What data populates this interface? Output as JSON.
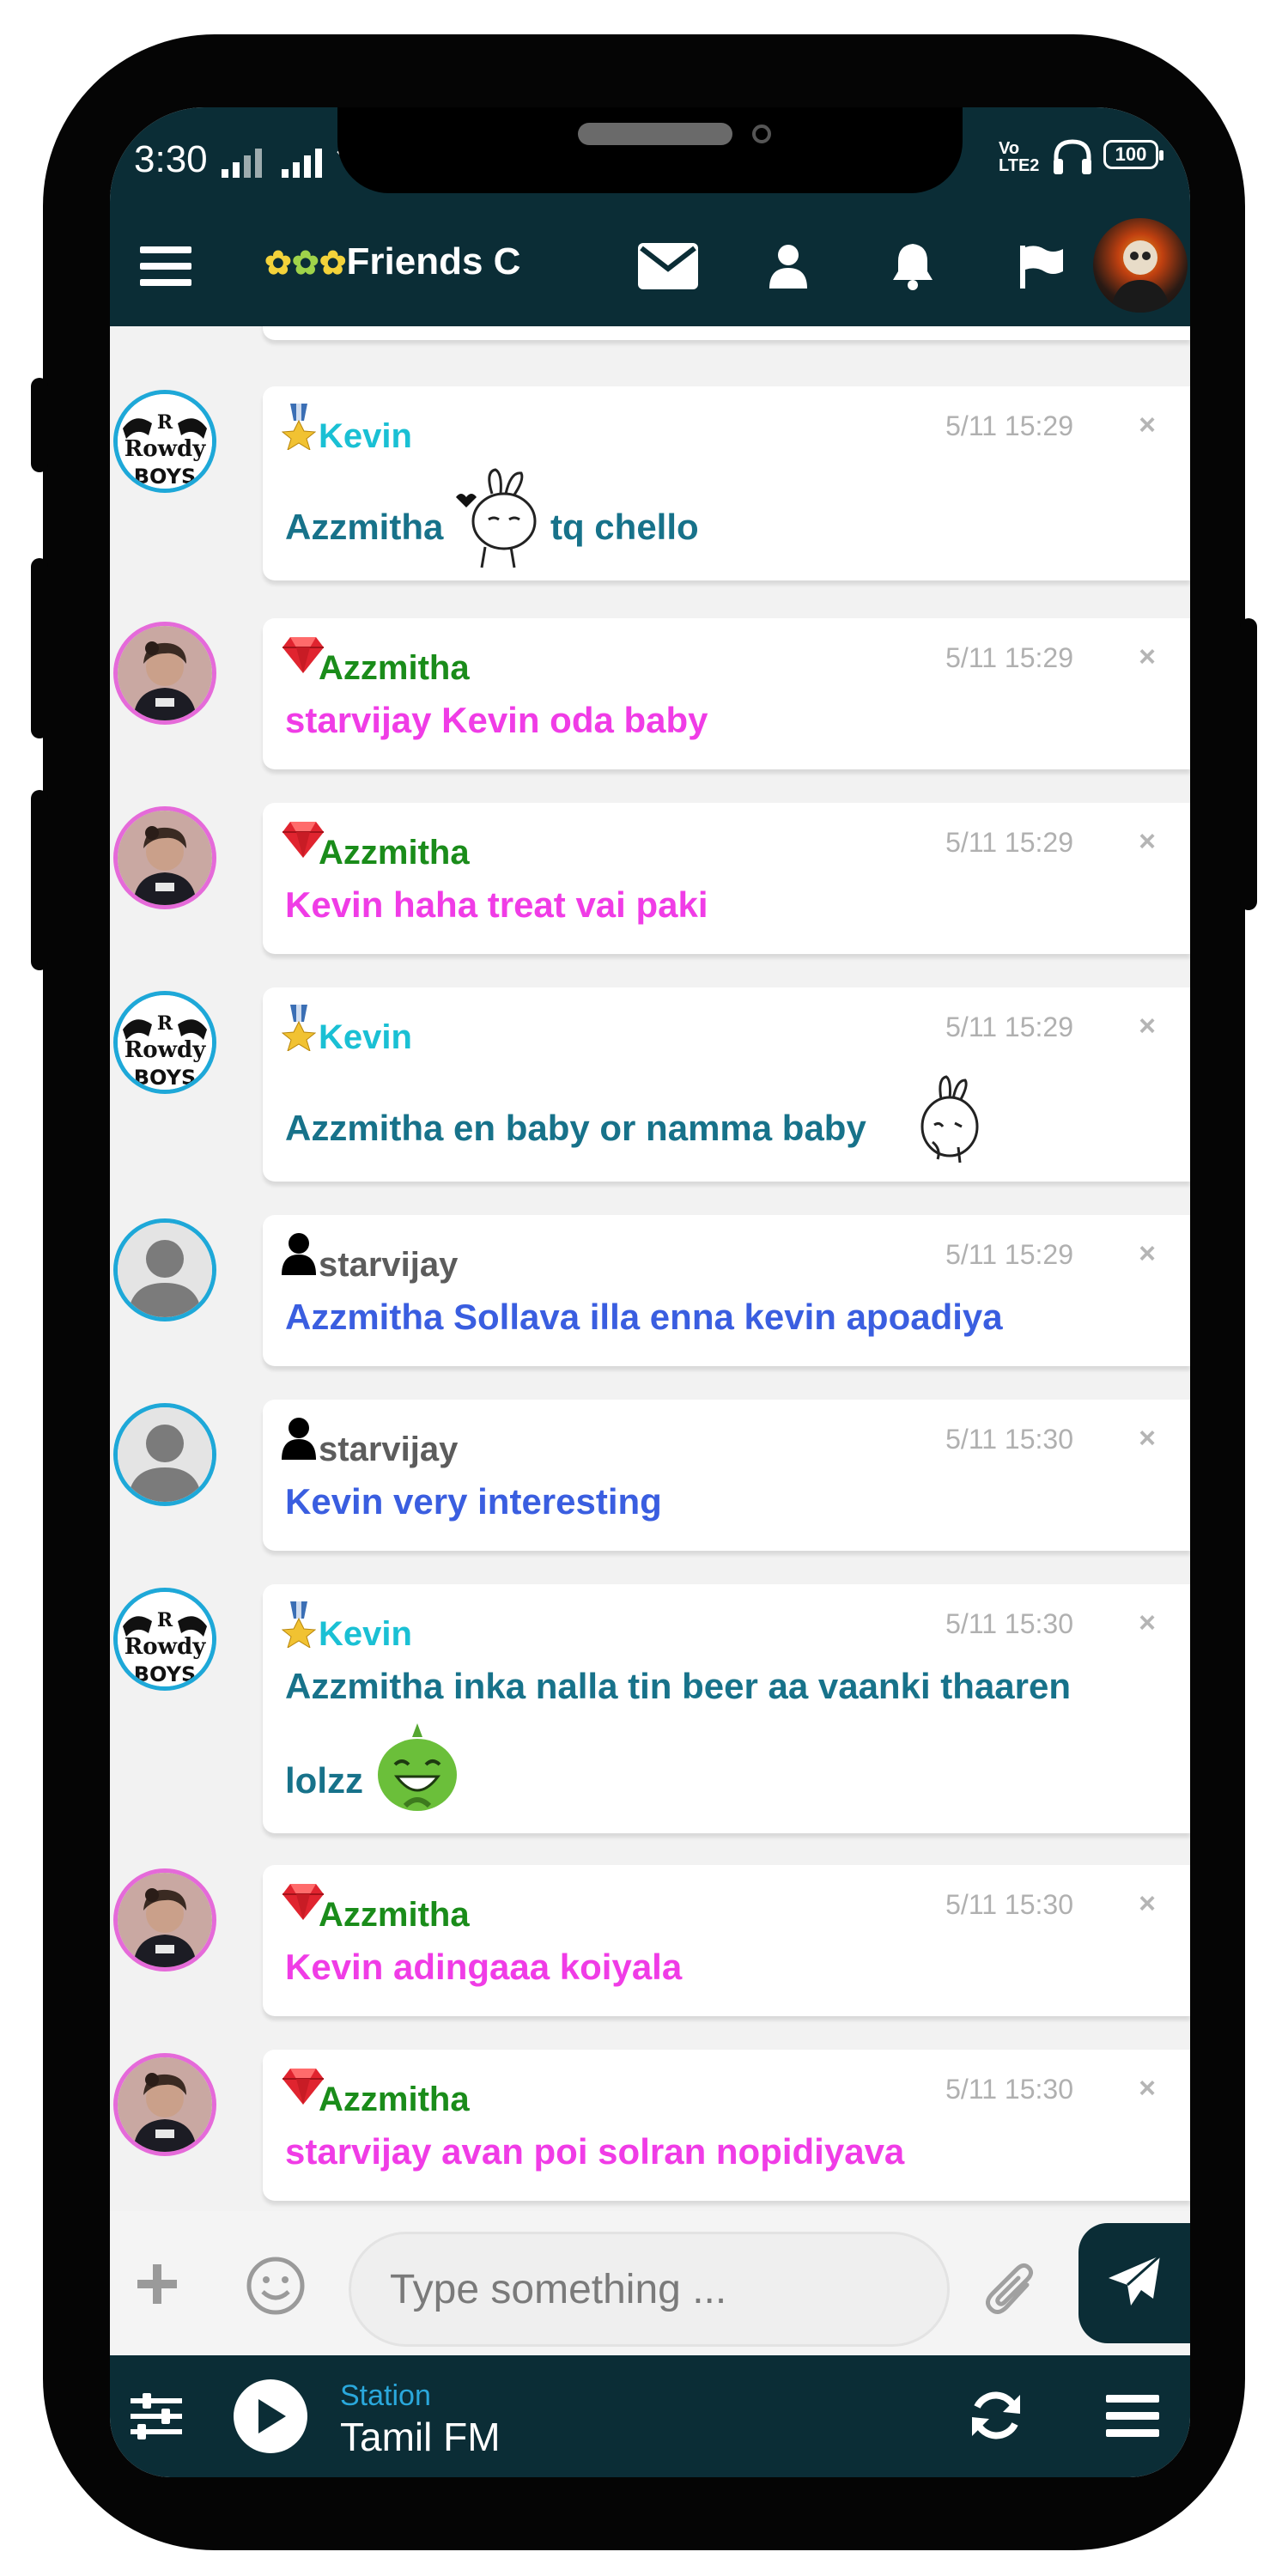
{
  "status_bar": {
    "time": "3:30",
    "network_tag": "Vo LTE2",
    "battery": "100"
  },
  "header": {
    "room_title": "Friends C",
    "icons": [
      "menu-icon",
      "envelope-icon",
      "user-icon",
      "bell-icon",
      "flag-icon"
    ]
  },
  "messages": [
    {
      "user": "Kevin",
      "rank": "medal",
      "time": "5/11 15:29",
      "text": "Azzmitha",
      "text_after": "tq chello",
      "sticker": "rabbit-blowing-kiss-sticker"
    },
    {
      "user": "Azzmitha",
      "rank": "gem",
      "time": "5/11 15:29",
      "text": "starvijay Kevin oda baby"
    },
    {
      "user": "Azzmitha",
      "rank": "gem",
      "time": "5/11 15:29",
      "text": "Kevin haha treat vai paki"
    },
    {
      "user": "Kevin",
      "rank": "medal",
      "time": "5/11 15:29",
      "text": "Azzmitha en baby or namma baby",
      "sticker": "rabbit-shy-sticker"
    },
    {
      "user": "starvijay",
      "rank": "user",
      "time": "5/11 15:29",
      "text": "Azzmitha Sollava illa enna kevin apoadiya"
    },
    {
      "user": "starvijay",
      "rank": "user",
      "time": "5/11 15:30",
      "text": "Kevin very interesting"
    },
    {
      "user": "Kevin",
      "rank": "medal",
      "time": "5/11 15:30",
      "text": "Azzmitha inka nalla tin beer aa vaanki thaaren",
      "text_line2": "lolzz",
      "sticker": "green-laughing-sticker"
    },
    {
      "user": "Azzmitha",
      "rank": "gem",
      "time": "5/11 15:30",
      "text": "Kevin adingaaa koiyala"
    },
    {
      "user": "Azzmitha",
      "rank": "gem",
      "time": "5/11 15:30",
      "text": "starvijay avan poi solran nopidiyava"
    }
  ],
  "close_symbol": "×",
  "avatar_text": {
    "rowdy_top": "R",
    "rowdy_mid": "Rowdy",
    "rowdy_bottom": "BOYS"
  },
  "composer": {
    "placeholder": "Type something ..."
  },
  "player": {
    "label": "Station",
    "station": "Tamil FM"
  },
  "colors": {
    "header_bg": "#0b2d36",
    "kevin_name": "#1ac0d4",
    "kevin_text": "#17728a",
    "azzmitha_name": "#1a8c1a",
    "azzmitha_text": "#f03ce6",
    "starvijay_name": "#5c5c5c",
    "starvijay_text": "#3a5ee0"
  }
}
